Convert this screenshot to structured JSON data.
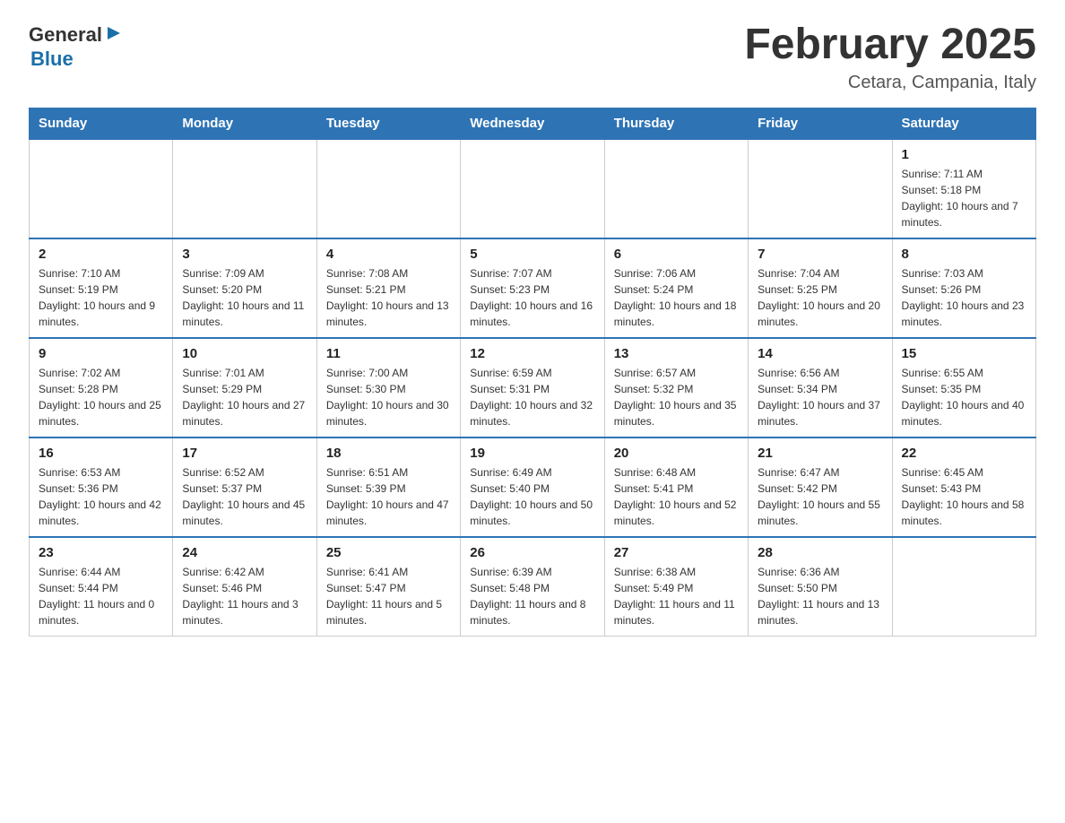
{
  "logo": {
    "text_general": "General",
    "arrow": "▶",
    "text_blue": "Blue"
  },
  "title": "February 2025",
  "location": "Cetara, Campania, Italy",
  "days_of_week": [
    "Sunday",
    "Monday",
    "Tuesday",
    "Wednesday",
    "Thursday",
    "Friday",
    "Saturday"
  ],
  "weeks": [
    [
      {
        "day": "",
        "info": ""
      },
      {
        "day": "",
        "info": ""
      },
      {
        "day": "",
        "info": ""
      },
      {
        "day": "",
        "info": ""
      },
      {
        "day": "",
        "info": ""
      },
      {
        "day": "",
        "info": ""
      },
      {
        "day": "1",
        "info": "Sunrise: 7:11 AM\nSunset: 5:18 PM\nDaylight: 10 hours and 7 minutes."
      }
    ],
    [
      {
        "day": "2",
        "info": "Sunrise: 7:10 AM\nSunset: 5:19 PM\nDaylight: 10 hours and 9 minutes."
      },
      {
        "day": "3",
        "info": "Sunrise: 7:09 AM\nSunset: 5:20 PM\nDaylight: 10 hours and 11 minutes."
      },
      {
        "day": "4",
        "info": "Sunrise: 7:08 AM\nSunset: 5:21 PM\nDaylight: 10 hours and 13 minutes."
      },
      {
        "day": "5",
        "info": "Sunrise: 7:07 AM\nSunset: 5:23 PM\nDaylight: 10 hours and 16 minutes."
      },
      {
        "day": "6",
        "info": "Sunrise: 7:06 AM\nSunset: 5:24 PM\nDaylight: 10 hours and 18 minutes."
      },
      {
        "day": "7",
        "info": "Sunrise: 7:04 AM\nSunset: 5:25 PM\nDaylight: 10 hours and 20 minutes."
      },
      {
        "day": "8",
        "info": "Sunrise: 7:03 AM\nSunset: 5:26 PM\nDaylight: 10 hours and 23 minutes."
      }
    ],
    [
      {
        "day": "9",
        "info": "Sunrise: 7:02 AM\nSunset: 5:28 PM\nDaylight: 10 hours and 25 minutes."
      },
      {
        "day": "10",
        "info": "Sunrise: 7:01 AM\nSunset: 5:29 PM\nDaylight: 10 hours and 27 minutes."
      },
      {
        "day": "11",
        "info": "Sunrise: 7:00 AM\nSunset: 5:30 PM\nDaylight: 10 hours and 30 minutes."
      },
      {
        "day": "12",
        "info": "Sunrise: 6:59 AM\nSunset: 5:31 PM\nDaylight: 10 hours and 32 minutes."
      },
      {
        "day": "13",
        "info": "Sunrise: 6:57 AM\nSunset: 5:32 PM\nDaylight: 10 hours and 35 minutes."
      },
      {
        "day": "14",
        "info": "Sunrise: 6:56 AM\nSunset: 5:34 PM\nDaylight: 10 hours and 37 minutes."
      },
      {
        "day": "15",
        "info": "Sunrise: 6:55 AM\nSunset: 5:35 PM\nDaylight: 10 hours and 40 minutes."
      }
    ],
    [
      {
        "day": "16",
        "info": "Sunrise: 6:53 AM\nSunset: 5:36 PM\nDaylight: 10 hours and 42 minutes."
      },
      {
        "day": "17",
        "info": "Sunrise: 6:52 AM\nSunset: 5:37 PM\nDaylight: 10 hours and 45 minutes."
      },
      {
        "day": "18",
        "info": "Sunrise: 6:51 AM\nSunset: 5:39 PM\nDaylight: 10 hours and 47 minutes."
      },
      {
        "day": "19",
        "info": "Sunrise: 6:49 AM\nSunset: 5:40 PM\nDaylight: 10 hours and 50 minutes."
      },
      {
        "day": "20",
        "info": "Sunrise: 6:48 AM\nSunset: 5:41 PM\nDaylight: 10 hours and 52 minutes."
      },
      {
        "day": "21",
        "info": "Sunrise: 6:47 AM\nSunset: 5:42 PM\nDaylight: 10 hours and 55 minutes."
      },
      {
        "day": "22",
        "info": "Sunrise: 6:45 AM\nSunset: 5:43 PM\nDaylight: 10 hours and 58 minutes."
      }
    ],
    [
      {
        "day": "23",
        "info": "Sunrise: 6:44 AM\nSunset: 5:44 PM\nDaylight: 11 hours and 0 minutes."
      },
      {
        "day": "24",
        "info": "Sunrise: 6:42 AM\nSunset: 5:46 PM\nDaylight: 11 hours and 3 minutes."
      },
      {
        "day": "25",
        "info": "Sunrise: 6:41 AM\nSunset: 5:47 PM\nDaylight: 11 hours and 5 minutes."
      },
      {
        "day": "26",
        "info": "Sunrise: 6:39 AM\nSunset: 5:48 PM\nDaylight: 11 hours and 8 minutes."
      },
      {
        "day": "27",
        "info": "Sunrise: 6:38 AM\nSunset: 5:49 PM\nDaylight: 11 hours and 11 minutes."
      },
      {
        "day": "28",
        "info": "Sunrise: 6:36 AM\nSunset: 5:50 PM\nDaylight: 11 hours and 13 minutes."
      },
      {
        "day": "",
        "info": ""
      }
    ]
  ]
}
